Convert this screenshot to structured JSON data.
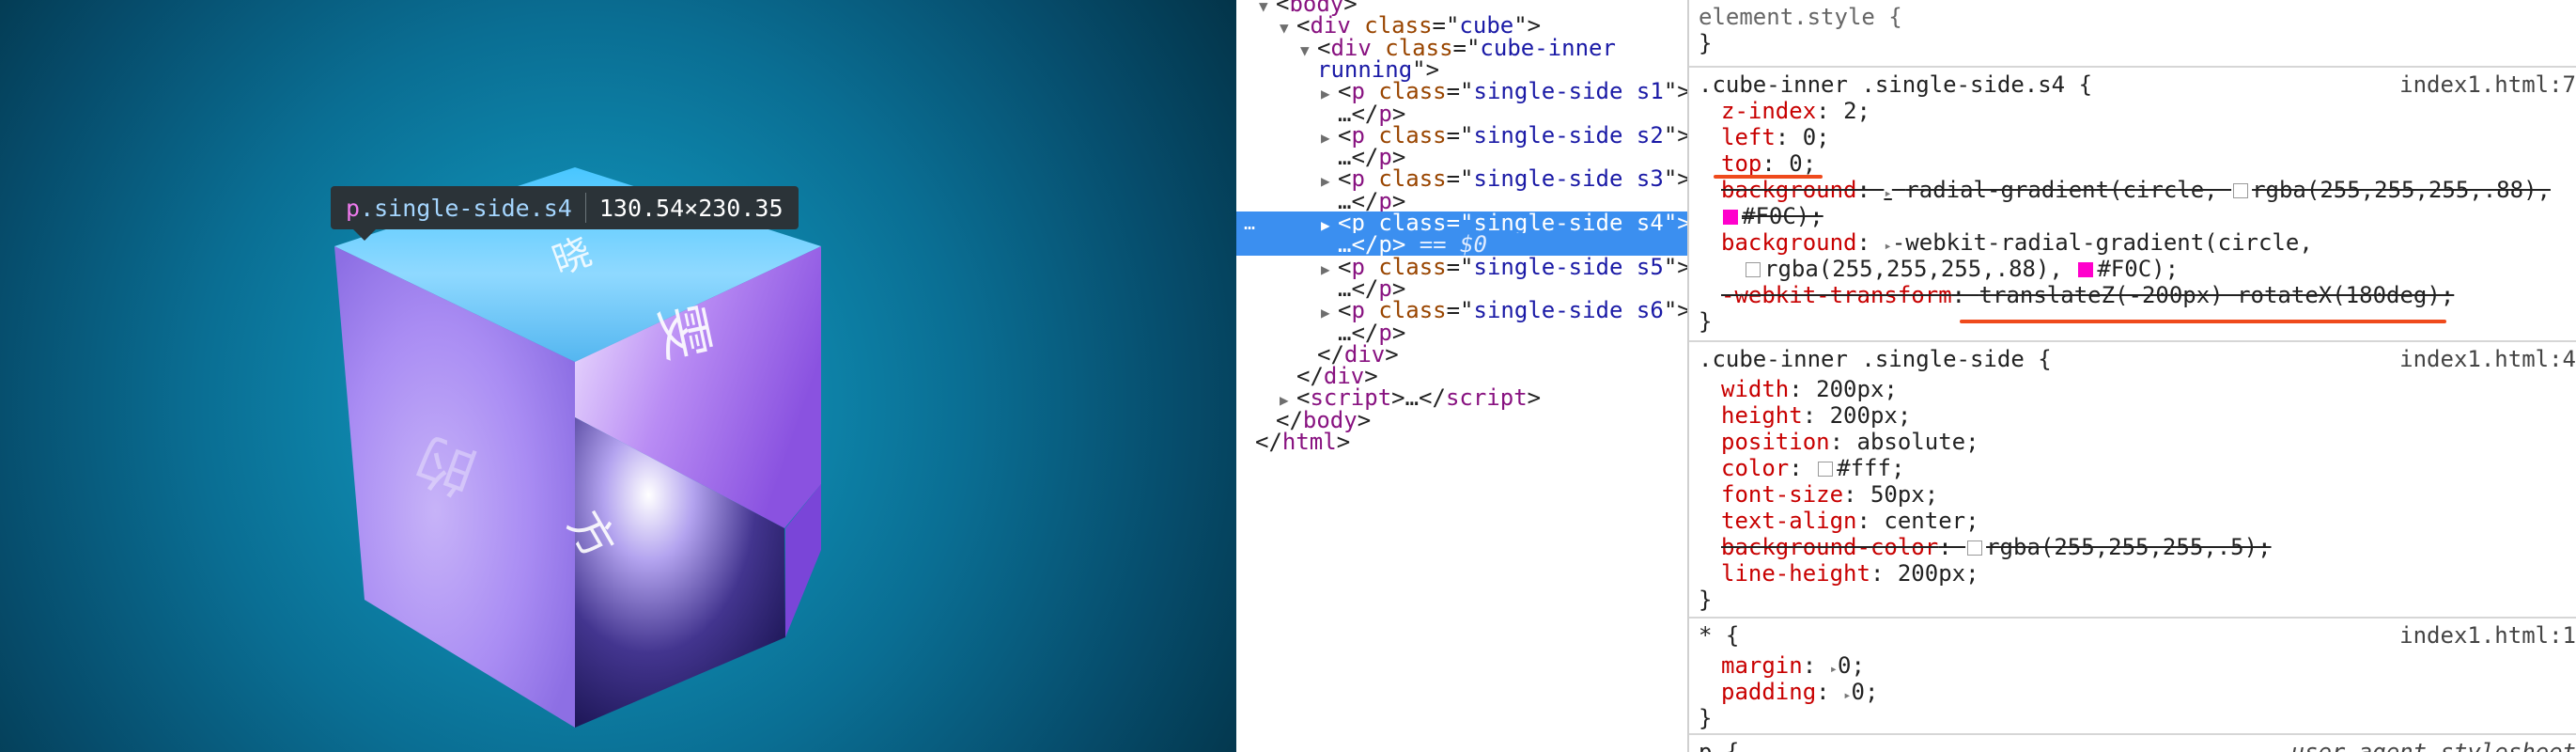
{
  "preview": {
    "tooltip": {
      "tag": "p",
      "class": ".single-side.s4",
      "size": "130.54×230.35"
    },
    "glyphs": [
      "晓",
      "雯",
      "的",
      "方"
    ]
  },
  "elements": {
    "lines": [
      {
        "i": 0,
        "tri": "▼",
        "parts": [
          [
            "pl",
            "<"
          ],
          [
            "tg",
            "body"
          ],
          [
            "pl",
            ">"
          ]
        ]
      },
      {
        "i": 1,
        "tri": "▼",
        "parts": [
          [
            "pl",
            "<"
          ],
          [
            "tg",
            "div"
          ],
          [
            "pl",
            " "
          ],
          [
            "at",
            "class"
          ],
          [
            "pl",
            "=\""
          ],
          [
            "av",
            "cube"
          ],
          [
            "pl",
            "\">"
          ]
        ]
      },
      {
        "i": 2,
        "tri": "▼",
        "parts": [
          [
            "pl",
            "<"
          ],
          [
            "tg",
            "div"
          ],
          [
            "pl",
            " "
          ],
          [
            "at",
            "class"
          ],
          [
            "pl",
            "=\""
          ],
          [
            "av",
            "cube-inner"
          ]
        ]
      },
      {
        "i": 2,
        "tri": "",
        "parts": [
          [
            "av",
            "running"
          ],
          [
            "pl",
            "\">"
          ]
        ]
      },
      {
        "i": 3,
        "tri": "▶",
        "parts": [
          [
            "pl",
            "<"
          ],
          [
            "tg",
            "p"
          ],
          [
            "pl",
            " "
          ],
          [
            "at",
            "class"
          ],
          [
            "pl",
            "=\""
          ],
          [
            "av",
            "single-side s1"
          ],
          [
            "pl",
            "\">"
          ]
        ]
      },
      {
        "i": 3,
        "tri": "",
        "parts": [
          [
            "pl",
            "…</"
          ],
          [
            "tg",
            "p"
          ],
          [
            "pl",
            ">"
          ]
        ]
      },
      {
        "i": 3,
        "tri": "▶",
        "parts": [
          [
            "pl",
            "<"
          ],
          [
            "tg",
            "p"
          ],
          [
            "pl",
            " "
          ],
          [
            "at",
            "class"
          ],
          [
            "pl",
            "=\""
          ],
          [
            "av",
            "single-side s2"
          ],
          [
            "pl",
            "\">"
          ]
        ]
      },
      {
        "i": 3,
        "tri": "",
        "parts": [
          [
            "pl",
            "…</"
          ],
          [
            "tg",
            "p"
          ],
          [
            "pl",
            ">"
          ]
        ]
      },
      {
        "i": 3,
        "tri": "▶",
        "parts": [
          [
            "pl",
            "<"
          ],
          [
            "tg",
            "p"
          ],
          [
            "pl",
            " "
          ],
          [
            "at",
            "class"
          ],
          [
            "pl",
            "=\""
          ],
          [
            "av",
            "single-side s3"
          ],
          [
            "pl",
            "\">"
          ]
        ]
      },
      {
        "i": 3,
        "tri": "",
        "parts": [
          [
            "pl",
            "…</"
          ],
          [
            "tg",
            "p"
          ],
          [
            "pl",
            ">"
          ]
        ]
      },
      {
        "i": 3,
        "tri": "▶",
        "sel": true,
        "parts": [
          [
            "pl",
            "<"
          ],
          [
            "tg",
            "p"
          ],
          [
            "pl",
            " "
          ],
          [
            "at",
            "class"
          ],
          [
            "pl",
            "=\""
          ],
          [
            "av",
            "single-side s4"
          ],
          [
            "pl",
            "\">"
          ]
        ]
      },
      {
        "i": 3,
        "tri": "",
        "sel": true,
        "parts": [
          [
            "pl",
            "…</"
          ],
          [
            "tg",
            "p"
          ],
          [
            "pl",
            "> "
          ],
          [
            "dim",
            "== $0"
          ]
        ]
      },
      {
        "i": 3,
        "tri": "▶",
        "parts": [
          [
            "pl",
            "<"
          ],
          [
            "tg",
            "p"
          ],
          [
            "pl",
            " "
          ],
          [
            "at",
            "class"
          ],
          [
            "pl",
            "=\""
          ],
          [
            "av",
            "single-side s5"
          ],
          [
            "pl",
            "\">"
          ]
        ]
      },
      {
        "i": 3,
        "tri": "",
        "parts": [
          [
            "pl",
            "…</"
          ],
          [
            "tg",
            "p"
          ],
          [
            "pl",
            ">"
          ]
        ]
      },
      {
        "i": 3,
        "tri": "▶",
        "parts": [
          [
            "pl",
            "<"
          ],
          [
            "tg",
            "p"
          ],
          [
            "pl",
            " "
          ],
          [
            "at",
            "class"
          ],
          [
            "pl",
            "=\""
          ],
          [
            "av",
            "single-side s6"
          ],
          [
            "pl",
            "\">"
          ]
        ]
      },
      {
        "i": 3,
        "tri": "",
        "parts": [
          [
            "pl",
            "…</"
          ],
          [
            "tg",
            "p"
          ],
          [
            "pl",
            ">"
          ]
        ]
      },
      {
        "i": 2,
        "tri": "",
        "parts": [
          [
            "pl",
            "</"
          ],
          [
            "tg",
            "div"
          ],
          [
            "pl",
            ">"
          ]
        ]
      },
      {
        "i": 1,
        "tri": "",
        "parts": [
          [
            "pl",
            "</"
          ],
          [
            "tg",
            "div"
          ],
          [
            "pl",
            ">"
          ]
        ]
      },
      {
        "i": 1,
        "tri": "▶",
        "parts": [
          [
            "pl",
            "<"
          ],
          [
            "tg",
            "script"
          ],
          [
            "pl",
            ">…</"
          ],
          [
            "tg",
            "script"
          ],
          [
            "pl",
            ">"
          ]
        ]
      },
      {
        "i": 0,
        "tri": "",
        "parts": [
          [
            "pl",
            "</"
          ],
          [
            "tg",
            "body"
          ],
          [
            "pl",
            ">"
          ]
        ]
      },
      {
        "i": -1,
        "tri": "",
        "parts": [
          [
            "pl",
            "</"
          ],
          [
            "tg",
            "html"
          ],
          [
            "pl",
            ">"
          ]
        ]
      }
    ],
    "dots": "…"
  },
  "styles": {
    "element_style": {
      "selector": "element.style {",
      "close": "}"
    },
    "rule_s4": {
      "selector": ".cube-inner .single-side.s4 {",
      "source": "index1.html:7",
      "decls": [
        {
          "name": "z-index",
          "value": "2;"
        },
        {
          "name": "left",
          "value": "0;"
        },
        {
          "name": "top",
          "value": "0;"
        },
        {
          "name": "background",
          "value": "radial-gradient(circle, ",
          "value2": "rgba(255,255,255,.88),",
          "struck": true
        },
        {
          "cont": "#F0C);",
          "struck": true
        },
        {
          "name": "background",
          "value": "-webkit-radial-gradient(circle,"
        },
        {
          "cont": "rgba(255,255,255,.88), ",
          "cont2": "#F0C);"
        },
        {
          "name": "-webkit-transform",
          "value": "translateZ(-200px) rotateX(180deg);",
          "struck": true,
          "grey": true
        }
      ],
      "close": "}"
    },
    "rule_side": {
      "selector": ".cube-inner .single-side {",
      "source": "index1.html:4",
      "decls": [
        {
          "name": "width",
          "value": "200px;"
        },
        {
          "name": "height",
          "value": "200px;"
        },
        {
          "name": "position",
          "value": "absolute;"
        },
        {
          "name": "color",
          "value": "#fff;"
        },
        {
          "name": "font-size",
          "value": "50px;"
        },
        {
          "name": "text-align",
          "value": "center;"
        },
        {
          "name": "background-color",
          "value": "rgba(255,255,255,.5);",
          "struck": true
        },
        {
          "name": "line-height",
          "value": "200px;"
        }
      ],
      "close": "}"
    },
    "rule_star": {
      "selector": "* {",
      "source": "index1.html:1",
      "decls": [
        {
          "name": "margin",
          "value": "0;"
        },
        {
          "name": "padding",
          "value": "0;"
        }
      ],
      "close": "}"
    },
    "ua_rule": {
      "selector": "p {",
      "source": "user agent stylesheet"
    },
    "colors": {
      "white_swatch": "#ffffff",
      "magenta": "#ff00cc",
      "underline": "#ef4a1c"
    }
  }
}
